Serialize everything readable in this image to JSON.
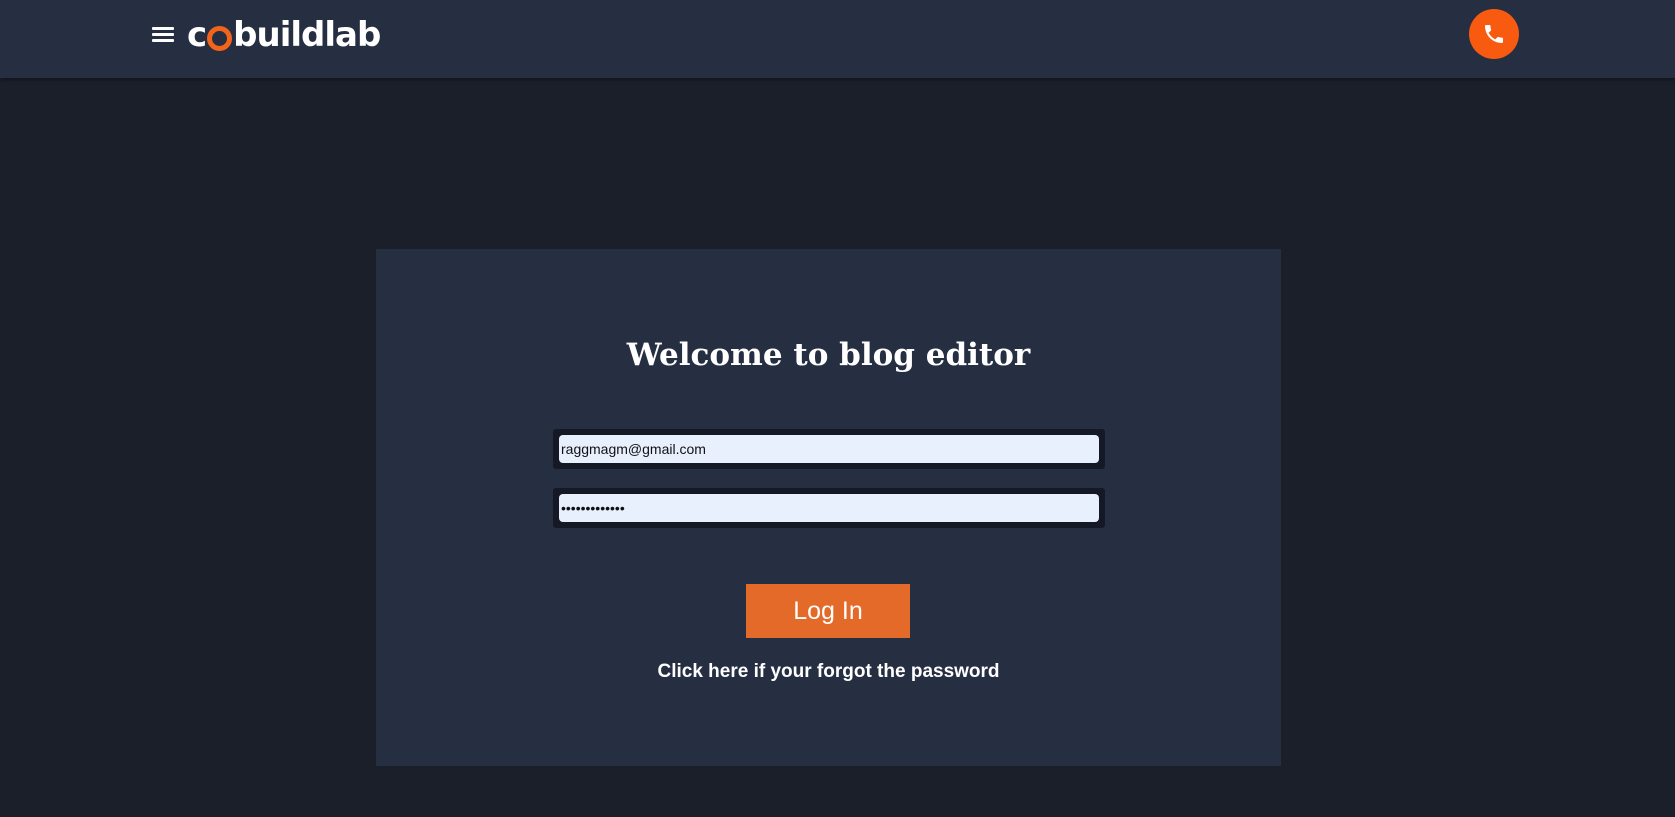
{
  "header": {
    "logo_prefix": "c",
    "logo_suffix": "buildlab",
    "icons": {
      "menu": "hamburger-menu-icon",
      "phone": "phone-icon"
    },
    "colors": {
      "accent": "#f85a10",
      "bar_background": "#262e42"
    }
  },
  "login": {
    "title": "Welcome to blog editor",
    "email_value": "raggmagm@gmail.com",
    "password_value": "•••••••••••••",
    "login_button_label": "Log In",
    "forgot_link_text": "Click here if your forgot the password",
    "colors": {
      "button": "#e46a2a",
      "card_background": "#262e42",
      "page_background": "#1b1f2a"
    }
  }
}
